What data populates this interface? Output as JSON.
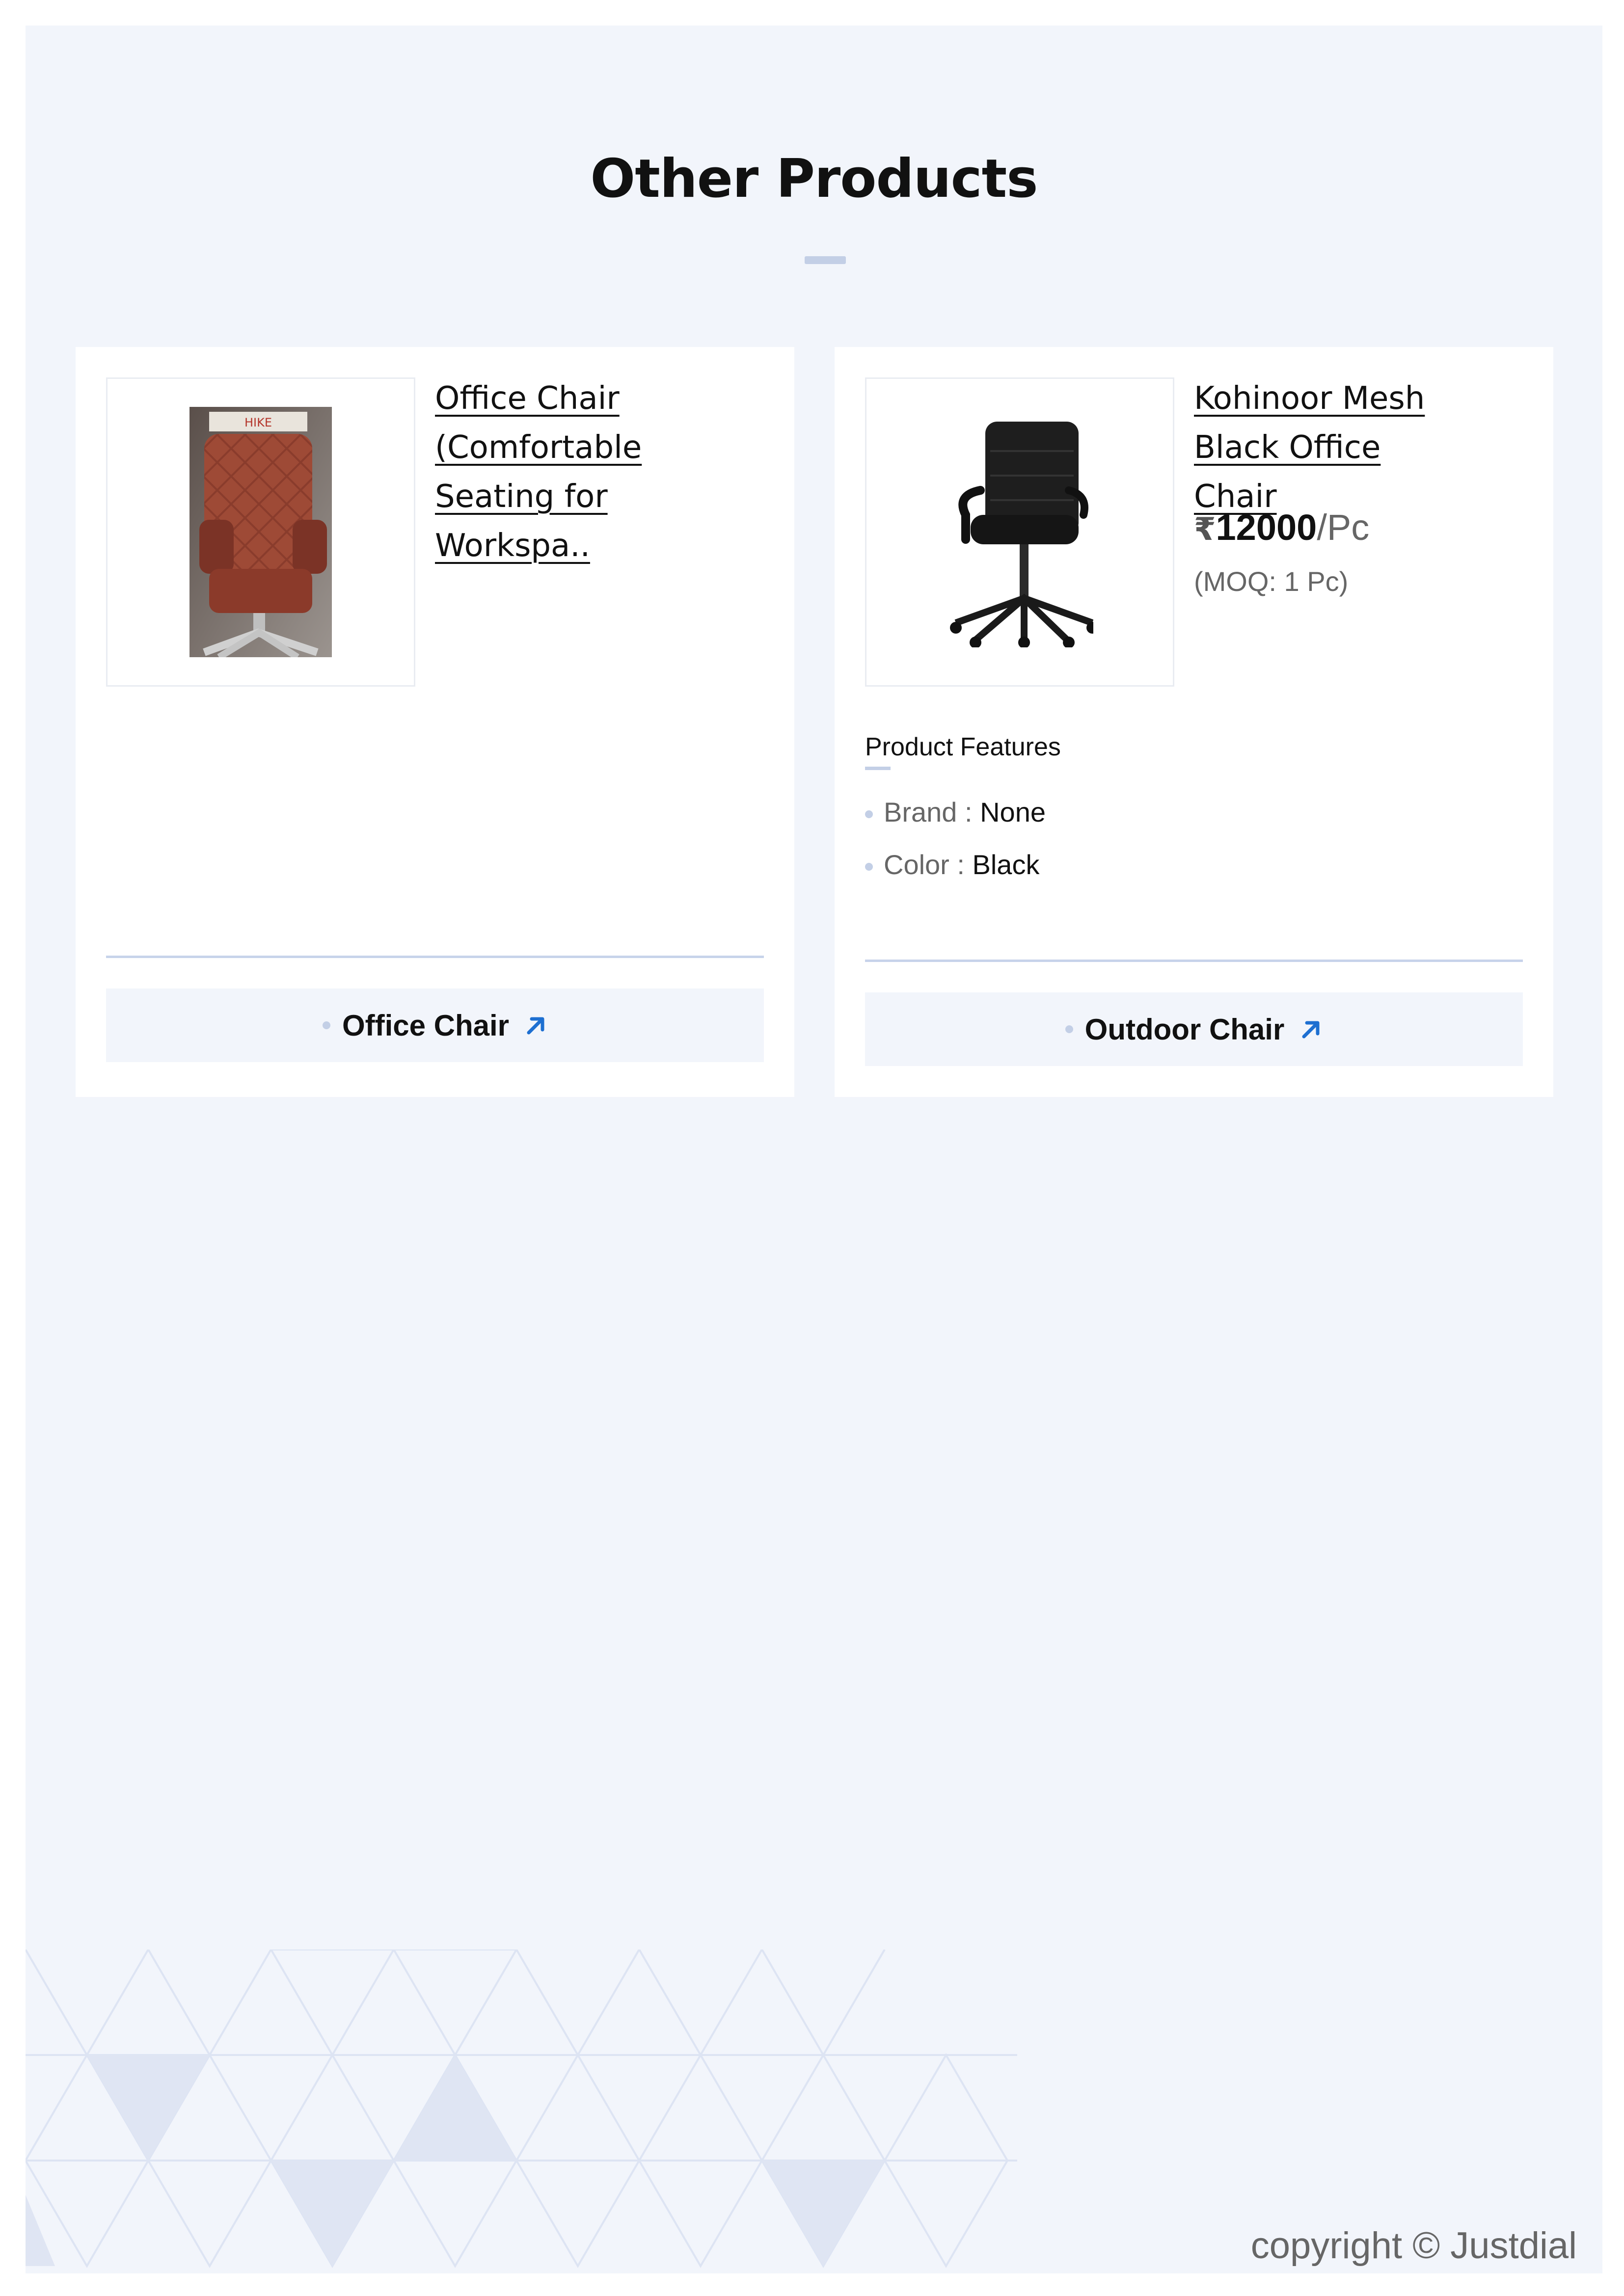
{
  "section": {
    "title": "Other Products"
  },
  "products": [
    {
      "name": "Office Chair (Comfortable Seating for Workspa..",
      "category": "Office Chair"
    },
    {
      "name": "Kohinoor Mesh Black Office Chair",
      "price_symbol": "₹",
      "price": "12000",
      "price_unit": "/Pc",
      "moq": "(MOQ: 1 Pc)",
      "features_heading": "Product Features",
      "features": [
        {
          "key": "Brand : ",
          "value": "None"
        },
        {
          "key": "Color : ",
          "value": "Black"
        }
      ],
      "category": "Outdoor Chair"
    }
  ],
  "footer": {
    "copyright": "copyright © Justdial"
  },
  "colors": {
    "accent": "#1d6fd1",
    "page_bg": "#f2f5fb",
    "divider": "#c7d3ea"
  }
}
